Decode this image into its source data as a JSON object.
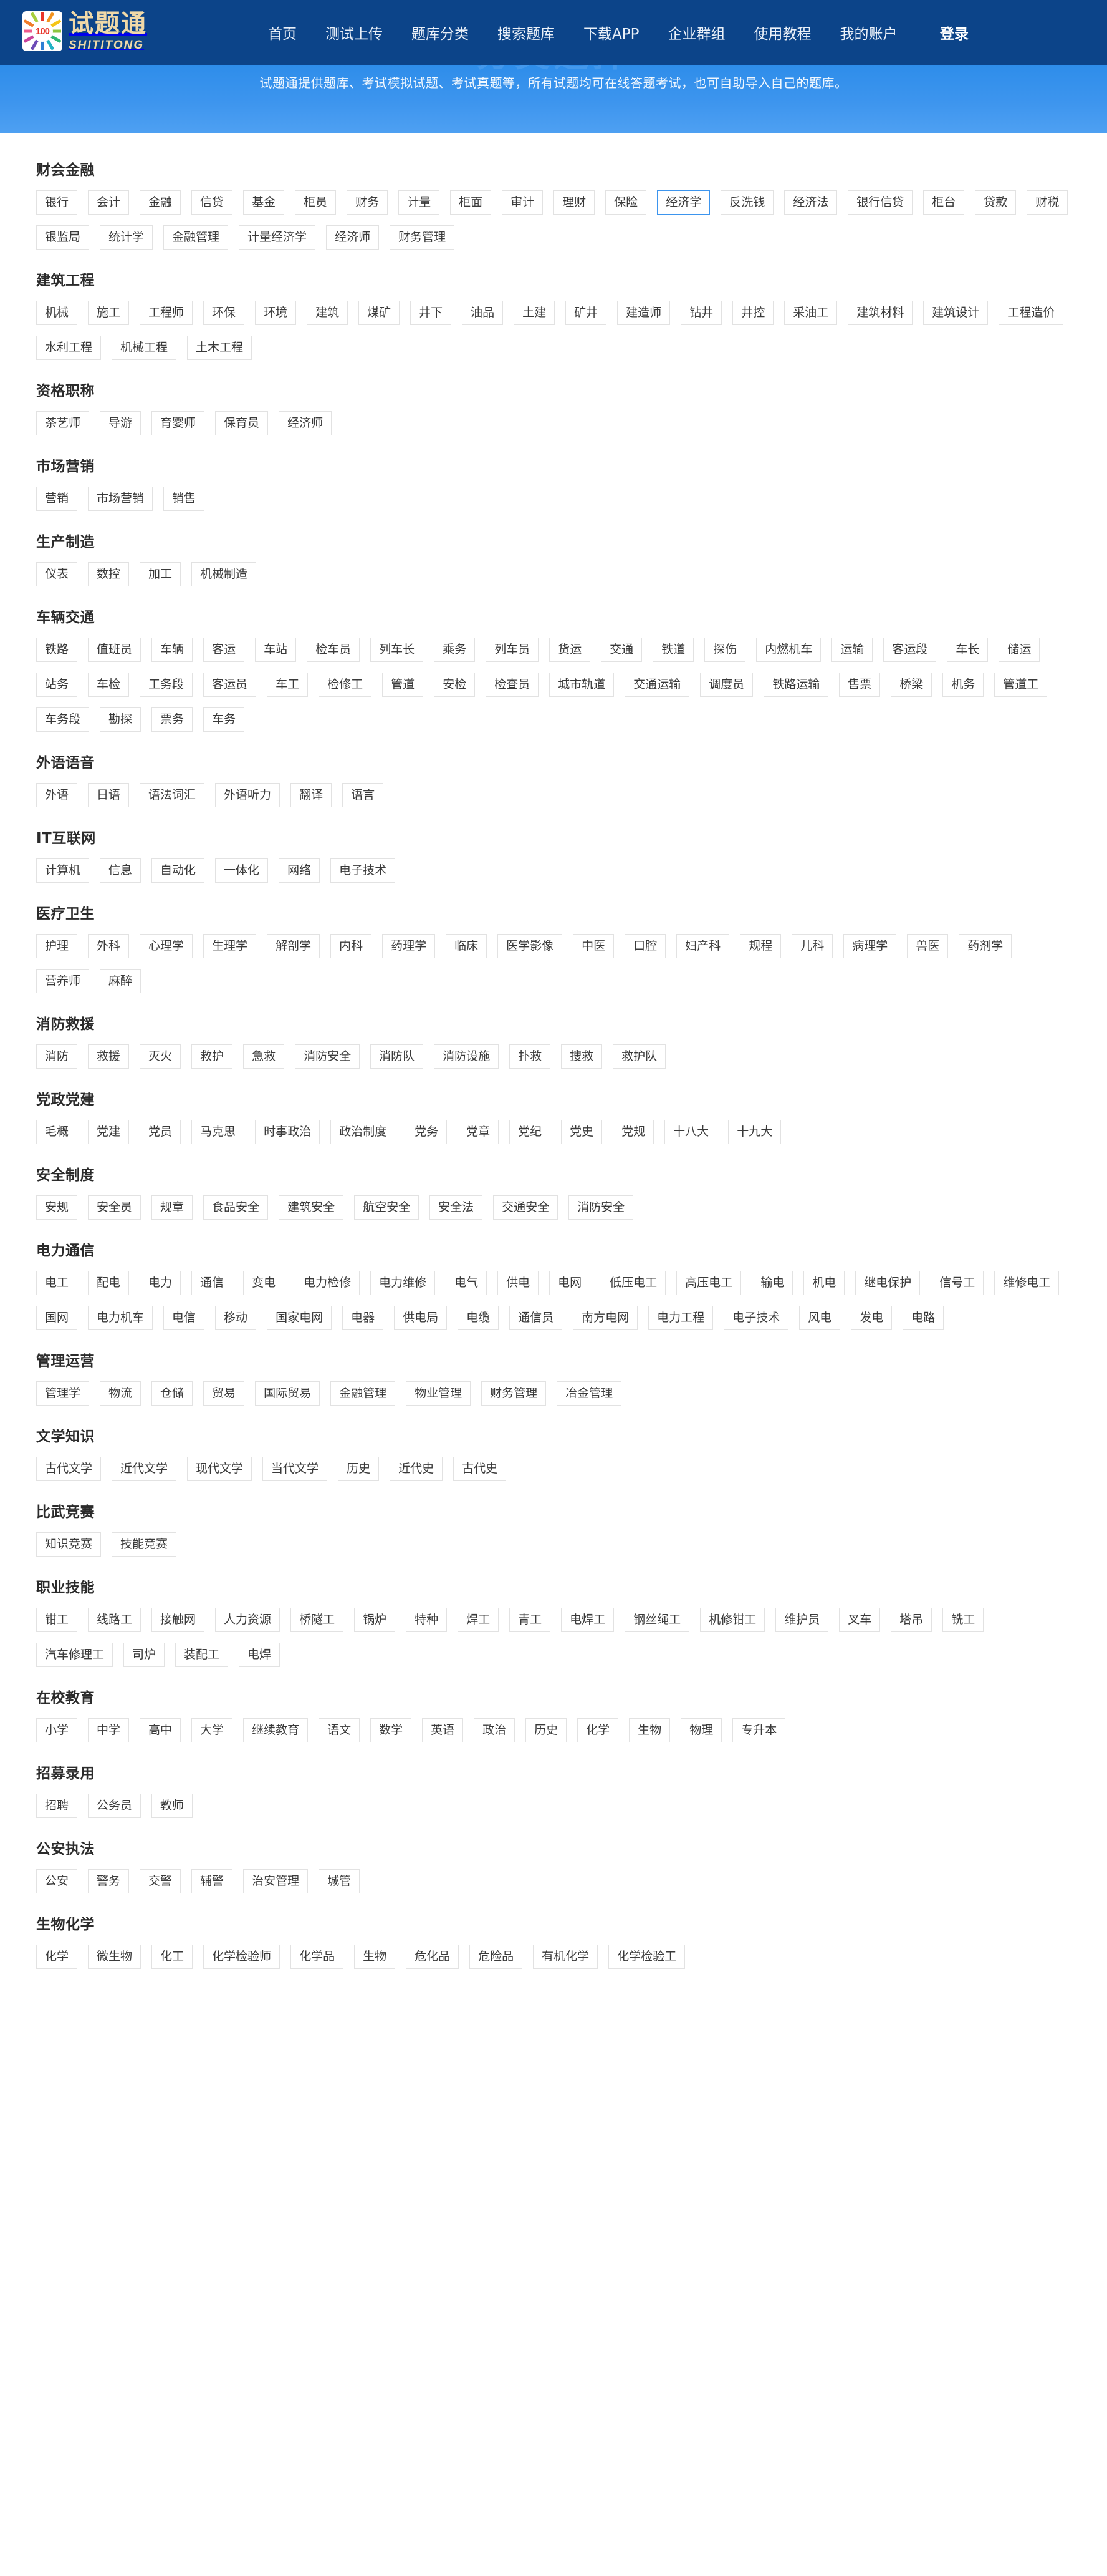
{
  "header": {
    "brand": {
      "logo_badge": "100",
      "name_cn": "试题通",
      "name_en": "SHITITONG",
      "icon": "sunburst-logo-icon"
    },
    "nav": [
      {
        "label": "首页"
      },
      {
        "label": "测试上传"
      },
      {
        "label": "题库分类"
      },
      {
        "label": "搜索题库"
      },
      {
        "label": "下载APP"
      },
      {
        "label": "企业群组"
      },
      {
        "label": "使用教程"
      },
      {
        "label": "我的账户"
      }
    ],
    "login_label": "登录",
    "brand_color": "#0c4489"
  },
  "banner": {
    "watermark": "分类选择",
    "text": "试题通提供题库、考试模拟试题、考试真题等，所有试题均可在线答题考试，也可自助导入自己的题库。",
    "bg_color": "#3d95ee"
  },
  "active_tag": "经济学",
  "categories": [
    {
      "title": "财会金融",
      "tags": [
        "银行",
        "会计",
        "金融",
        "信贷",
        "基金",
        "柜员",
        "财务",
        "计量",
        "柜面",
        "审计",
        "理财",
        "保险",
        "经济学",
        "反洗钱",
        "经济法",
        "银行信贷",
        "柜台",
        "贷款",
        "财税",
        "银监局",
        "统计学",
        "金融管理",
        "计量经济学",
        "经济师",
        "财务管理"
      ]
    },
    {
      "title": "建筑工程",
      "tags": [
        "机械",
        "施工",
        "工程师",
        "环保",
        "环境",
        "建筑",
        "煤矿",
        "井下",
        "油品",
        "土建",
        "矿井",
        "建造师",
        "钻井",
        "井控",
        "采油工",
        "建筑材料",
        "建筑设计",
        "工程造价",
        "水利工程",
        "机械工程",
        "土木工程"
      ]
    },
    {
      "title": "资格职称",
      "tags": [
        "茶艺师",
        "导游",
        "育婴师",
        "保育员",
        "经济师"
      ]
    },
    {
      "title": "市场营销",
      "tags": [
        "营销",
        "市场营销",
        "销售"
      ]
    },
    {
      "title": "生产制造",
      "tags": [
        "仪表",
        "数控",
        "加工",
        "机械制造"
      ]
    },
    {
      "title": "车辆交通",
      "tags": [
        "铁路",
        "值班员",
        "车辆",
        "客运",
        "车站",
        "检车员",
        "列车长",
        "乘务",
        "列车员",
        "货运",
        "交通",
        "铁道",
        "探伤",
        "内燃机车",
        "运输",
        "客运段",
        "车长",
        "储运",
        "站务",
        "车检",
        "工务段",
        "客运员",
        "车工",
        "检修工",
        "管道",
        "安检",
        "检查员",
        "城市轨道",
        "交通运输",
        "调度员",
        "铁路运输",
        "售票",
        "桥梁",
        "机务",
        "管道工",
        "车务段",
        "勘探",
        "票务",
        "车务"
      ]
    },
    {
      "title": "外语语音",
      "tags": [
        "外语",
        "日语",
        "语法词汇",
        "外语听力",
        "翻译",
        "语言"
      ]
    },
    {
      "title": "IT互联网",
      "tags": [
        "计算机",
        "信息",
        "自动化",
        "一体化",
        "网络",
        "电子技术"
      ]
    },
    {
      "title": "医疗卫生",
      "tags": [
        "护理",
        "外科",
        "心理学",
        "生理学",
        "解剖学",
        "内科",
        "药理学",
        "临床",
        "医学影像",
        "中医",
        "口腔",
        "妇产科",
        "规程",
        "儿科",
        "病理学",
        "兽医",
        "药剂学",
        "营养师",
        "麻醉"
      ]
    },
    {
      "title": "消防救援",
      "tags": [
        "消防",
        "救援",
        "灭火",
        "救护",
        "急救",
        "消防安全",
        "消防队",
        "消防设施",
        "扑救",
        "搜救",
        "救护队"
      ]
    },
    {
      "title": "党政党建",
      "tags": [
        "毛概",
        "党建",
        "党员",
        "马克思",
        "时事政治",
        "政治制度",
        "党务",
        "党章",
        "党纪",
        "党史",
        "党规",
        "十八大",
        "十九大"
      ]
    },
    {
      "title": "安全制度",
      "tags": [
        "安规",
        "安全员",
        "规章",
        "食品安全",
        "建筑安全",
        "航空安全",
        "安全法",
        "交通安全",
        "消防安全"
      ]
    },
    {
      "title": "电力通信",
      "tags": [
        "电工",
        "配电",
        "电力",
        "通信",
        "变电",
        "电力检修",
        "电力维修",
        "电气",
        "供电",
        "电网",
        "低压电工",
        "高压电工",
        "输电",
        "机电",
        "继电保护",
        "信号工",
        "维修电工",
        "国网",
        "电力机车",
        "电信",
        "移动",
        "国家电网",
        "电器",
        "供电局",
        "电缆",
        "通信员",
        "南方电网",
        "电力工程",
        "电子技术",
        "风电",
        "发电",
        "电路"
      ]
    },
    {
      "title": "管理运营",
      "tags": [
        "管理学",
        "物流",
        "仓储",
        "贸易",
        "国际贸易",
        "金融管理",
        "物业管理",
        "财务管理",
        "冶金管理"
      ]
    },
    {
      "title": "文学知识",
      "tags": [
        "古代文学",
        "近代文学",
        "现代文学",
        "当代文学",
        "历史",
        "近代史",
        "古代史"
      ]
    },
    {
      "title": "比武竞赛",
      "tags": [
        "知识竞赛",
        "技能竞赛"
      ]
    },
    {
      "title": "职业技能",
      "tags": [
        "钳工",
        "线路工",
        "接触网",
        "人力资源",
        "桥隧工",
        "锅炉",
        "特种",
        "焊工",
        "青工",
        "电焊工",
        "钢丝绳工",
        "机修钳工",
        "维护员",
        "叉车",
        "塔吊",
        "铣工",
        "汽车修理工",
        "司炉",
        "装配工",
        "电焊"
      ]
    },
    {
      "title": "在校教育",
      "tags": [
        "小学",
        "中学",
        "高中",
        "大学",
        "继续教育",
        "语文",
        "数学",
        "英语",
        "政治",
        "历史",
        "化学",
        "生物",
        "物理",
        "专升本"
      ]
    },
    {
      "title": "招募录用",
      "tags": [
        "招聘",
        "公务员",
        "教师"
      ]
    },
    {
      "title": "公安执法",
      "tags": [
        "公安",
        "警务",
        "交警",
        "辅警",
        "治安管理",
        "城管"
      ]
    },
    {
      "title": "生物化学",
      "tags": [
        "化学",
        "微生物",
        "化工",
        "化学检验师",
        "化学品",
        "生物",
        "危化品",
        "危险品",
        "有机化学",
        "化学检验工"
      ]
    }
  ]
}
